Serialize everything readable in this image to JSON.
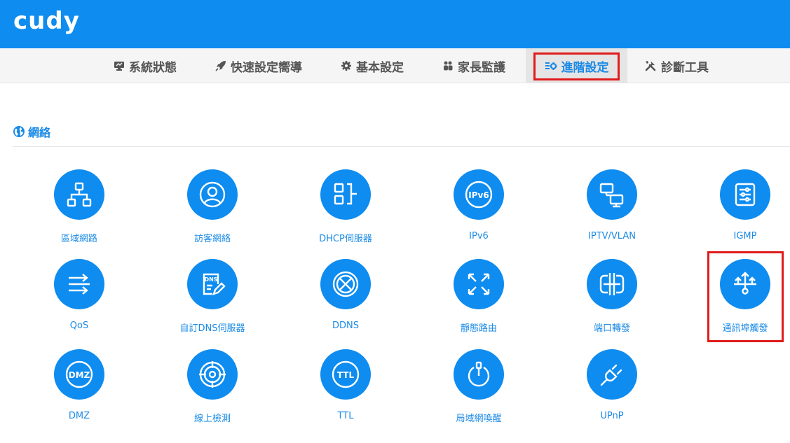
{
  "header": {
    "logo_text": "cudy",
    "brand_color": "#0e8cf0"
  },
  "nav": {
    "items": [
      {
        "label": "系統狀態",
        "icon": "monitor-icon"
      },
      {
        "label": "快速設定嚮導",
        "icon": "rocket-icon"
      },
      {
        "label": "基本設定",
        "icon": "gear-icon"
      },
      {
        "label": "家長監護",
        "icon": "users-icon"
      },
      {
        "label": "進階設定",
        "icon": "advanced-settings-icon",
        "active": true
      },
      {
        "label": "診斷工具",
        "icon": "tools-icon"
      }
    ],
    "active_color": "#1a8ae6",
    "highlight_color": "#e01b1b"
  },
  "section": {
    "title": "網絡",
    "icon": "globe-icon"
  },
  "tiles": [
    {
      "label": "區域網路",
      "icon": "lan-tree-icon"
    },
    {
      "label": "訪客網絡",
      "icon": "guest-user-icon"
    },
    {
      "label": "DHCP伺服器",
      "icon": "dhcp-blocks-icon"
    },
    {
      "label": "IPv6",
      "icon": "ipv6-icon"
    },
    {
      "label": "IPTV/VLAN",
      "icon": "iptv-monitors-icon"
    },
    {
      "label": "IGMP",
      "icon": "igmp-sliders-icon"
    },
    {
      "label": "QoS",
      "icon": "qos-arrows-icon"
    },
    {
      "label": "自訂DNS伺服器",
      "icon": "dns-document-icon"
    },
    {
      "label": "DDNS",
      "icon": "ddns-globe-icon"
    },
    {
      "label": "靜態路由",
      "icon": "static-route-arrows-icon"
    },
    {
      "label": "端口轉發",
      "icon": "port-forward-icon"
    },
    {
      "label": "通訊埠觸發",
      "icon": "port-trigger-icon",
      "highlighted": true
    },
    {
      "label": "DMZ",
      "icon": "dmz-icon"
    },
    {
      "label": "線上檢測",
      "icon": "online-detect-target-icon"
    },
    {
      "label": "TTL",
      "icon": "ttl-icon"
    },
    {
      "label": "局域網喚醒",
      "icon": "wake-on-lan-power-icon"
    },
    {
      "label": "UPnP",
      "icon": "upnp-plug-icon"
    }
  ]
}
